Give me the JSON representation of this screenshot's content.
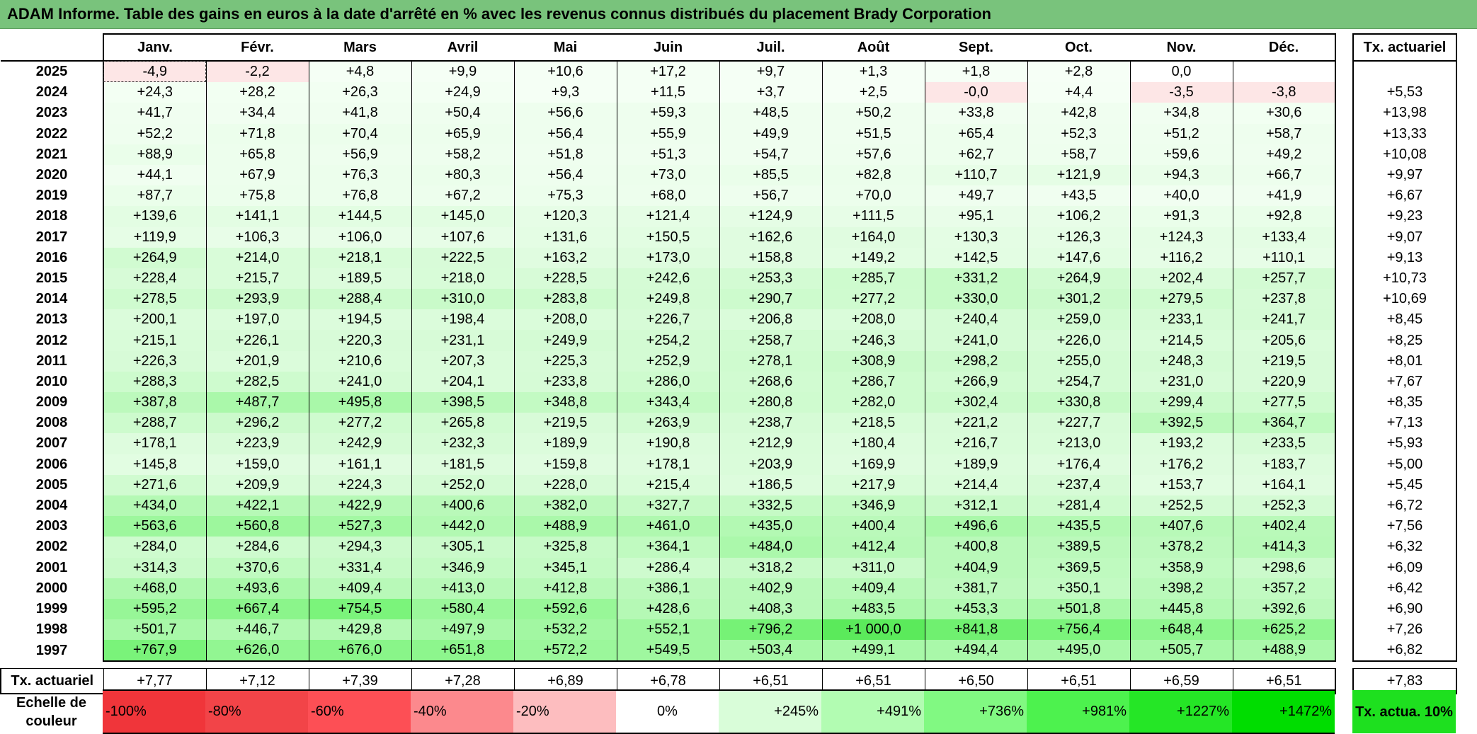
{
  "title": "ADAM Informe. Table des gains en euros à la date d'arrêté en % avec les revenus connus distribués du placement Brady Corporation",
  "months": [
    "Janv.",
    "Févr.",
    "Mars",
    "Avril",
    "Mai",
    "Juin",
    "Juil.",
    "Août",
    "Sept.",
    "Oct.",
    "Nov.",
    "Déc."
  ],
  "tx_header": "Tx. actuariel",
  "rows": [
    {
      "year": "2025",
      "values": [
        "-4,9",
        "-2,2",
        "+4,8",
        "+9,9",
        "+10,6",
        "+17,2",
        "+9,7",
        "+1,3",
        "+1,8",
        "+2,8",
        "0,0",
        ""
      ],
      "tx": ""
    },
    {
      "year": "2024",
      "values": [
        "+24,3",
        "+28,2",
        "+26,3",
        "+24,9",
        "+9,3",
        "+11,5",
        "+3,7",
        "+2,5",
        "-0,0",
        "+4,4",
        "-3,5",
        "-3,8"
      ],
      "tx": "+5,53"
    },
    {
      "year": "2023",
      "values": [
        "+41,7",
        "+34,4",
        "+41,8",
        "+50,4",
        "+56,6",
        "+59,3",
        "+48,5",
        "+50,2",
        "+33,8",
        "+42,8",
        "+34,8",
        "+30,6"
      ],
      "tx": "+13,98"
    },
    {
      "year": "2022",
      "values": [
        "+52,2",
        "+71,8",
        "+70,4",
        "+65,9",
        "+56,4",
        "+55,9",
        "+49,9",
        "+51,5",
        "+65,4",
        "+52,3",
        "+51,2",
        "+58,7"
      ],
      "tx": "+13,33"
    },
    {
      "year": "2021",
      "values": [
        "+88,9",
        "+65,8",
        "+56,9",
        "+58,2",
        "+51,8",
        "+51,3",
        "+54,7",
        "+57,6",
        "+62,7",
        "+58,7",
        "+59,6",
        "+49,2"
      ],
      "tx": "+10,08"
    },
    {
      "year": "2020",
      "values": [
        "+44,1",
        "+67,9",
        "+76,3",
        "+80,3",
        "+56,4",
        "+73,0",
        "+85,5",
        "+82,8",
        "+110,7",
        "+121,9",
        "+94,3",
        "+66,7"
      ],
      "tx": "+9,97"
    },
    {
      "year": "2019",
      "values": [
        "+87,7",
        "+75,8",
        "+76,8",
        "+67,2",
        "+75,3",
        "+68,0",
        "+56,7",
        "+70,0",
        "+49,7",
        "+43,5",
        "+40,0",
        "+41,9"
      ],
      "tx": "+6,67"
    },
    {
      "year": "2018",
      "values": [
        "+139,6",
        "+141,1",
        "+144,5",
        "+145,0",
        "+120,3",
        "+121,4",
        "+124,9",
        "+111,5",
        "+95,1",
        "+106,2",
        "+91,3",
        "+92,8"
      ],
      "tx": "+9,23"
    },
    {
      "year": "2017",
      "values": [
        "+119,9",
        "+106,3",
        "+106,0",
        "+107,6",
        "+131,6",
        "+150,5",
        "+162,6",
        "+164,0",
        "+130,3",
        "+126,3",
        "+124,3",
        "+133,4"
      ],
      "tx": "+9,07"
    },
    {
      "year": "2016",
      "values": [
        "+264,9",
        "+214,0",
        "+218,1",
        "+222,5",
        "+163,2",
        "+173,0",
        "+158,8",
        "+149,2",
        "+142,5",
        "+147,6",
        "+116,2",
        "+110,1"
      ],
      "tx": "+9,13"
    },
    {
      "year": "2015",
      "values": [
        "+228,4",
        "+215,7",
        "+189,5",
        "+218,0",
        "+228,5",
        "+242,6",
        "+253,3",
        "+285,7",
        "+331,2",
        "+264,9",
        "+202,4",
        "+257,7"
      ],
      "tx": "+10,73"
    },
    {
      "year": "2014",
      "values": [
        "+278,5",
        "+293,9",
        "+288,4",
        "+310,0",
        "+283,8",
        "+249,8",
        "+290,7",
        "+277,2",
        "+330,0",
        "+301,2",
        "+279,5",
        "+237,8"
      ],
      "tx": "+10,69"
    },
    {
      "year": "2013",
      "values": [
        "+200,1",
        "+197,0",
        "+194,5",
        "+198,4",
        "+208,0",
        "+226,7",
        "+206,8",
        "+208,0",
        "+240,4",
        "+259,0",
        "+233,1",
        "+241,7"
      ],
      "tx": "+8,45"
    },
    {
      "year": "2012",
      "values": [
        "+215,1",
        "+226,1",
        "+220,3",
        "+231,1",
        "+249,9",
        "+254,2",
        "+258,7",
        "+246,3",
        "+241,0",
        "+226,0",
        "+214,5",
        "+205,6"
      ],
      "tx": "+8,25"
    },
    {
      "year": "2011",
      "values": [
        "+226,3",
        "+201,9",
        "+210,6",
        "+207,3",
        "+225,3",
        "+252,9",
        "+278,1",
        "+308,9",
        "+298,2",
        "+255,0",
        "+248,3",
        "+219,5"
      ],
      "tx": "+8,01"
    },
    {
      "year": "2010",
      "values": [
        "+288,3",
        "+282,5",
        "+241,0",
        "+204,1",
        "+233,8",
        "+286,0",
        "+268,6",
        "+286,7",
        "+266,9",
        "+254,7",
        "+231,0",
        "+220,9"
      ],
      "tx": "+7,67"
    },
    {
      "year": "2009",
      "values": [
        "+387,8",
        "+487,7",
        "+495,8",
        "+398,5",
        "+348,8",
        "+343,4",
        "+280,8",
        "+282,0",
        "+302,4",
        "+330,8",
        "+299,4",
        "+277,5"
      ],
      "tx": "+8,35"
    },
    {
      "year": "2008",
      "values": [
        "+288,7",
        "+296,2",
        "+277,2",
        "+265,8",
        "+219,5",
        "+263,9",
        "+238,7",
        "+218,5",
        "+221,2",
        "+227,7",
        "+392,5",
        "+364,7"
      ],
      "tx": "+7,13"
    },
    {
      "year": "2007",
      "values": [
        "+178,1",
        "+223,9",
        "+242,9",
        "+232,3",
        "+189,9",
        "+190,8",
        "+212,9",
        "+180,4",
        "+216,7",
        "+213,0",
        "+193,2",
        "+233,5"
      ],
      "tx": "+5,93"
    },
    {
      "year": "2006",
      "values": [
        "+145,8",
        "+159,0",
        "+161,1",
        "+181,5",
        "+159,8",
        "+178,1",
        "+203,9",
        "+169,9",
        "+189,9",
        "+176,4",
        "+176,2",
        "+183,7"
      ],
      "tx": "+5,00"
    },
    {
      "year": "2005",
      "values": [
        "+271,6",
        "+209,9",
        "+224,3",
        "+252,0",
        "+228,0",
        "+215,4",
        "+186,5",
        "+217,9",
        "+214,4",
        "+237,4",
        "+153,7",
        "+164,1"
      ],
      "tx": "+5,45"
    },
    {
      "year": "2004",
      "values": [
        "+434,0",
        "+422,1",
        "+422,9",
        "+400,6",
        "+382,0",
        "+327,7",
        "+332,5",
        "+346,9",
        "+312,1",
        "+281,4",
        "+252,5",
        "+252,3"
      ],
      "tx": "+6,72"
    },
    {
      "year": "2003",
      "values": [
        "+563,6",
        "+560,8",
        "+527,3",
        "+442,0",
        "+488,9",
        "+461,0",
        "+435,0",
        "+400,4",
        "+496,6",
        "+435,5",
        "+407,6",
        "+402,4"
      ],
      "tx": "+7,56"
    },
    {
      "year": "2002",
      "values": [
        "+284,0",
        "+284,6",
        "+294,3",
        "+305,1",
        "+325,8",
        "+364,1",
        "+484,0",
        "+412,4",
        "+400,8",
        "+389,5",
        "+378,2",
        "+414,3"
      ],
      "tx": "+6,32"
    },
    {
      "year": "2001",
      "values": [
        "+314,3",
        "+370,6",
        "+331,4",
        "+346,9",
        "+345,1",
        "+286,4",
        "+318,2",
        "+311,0",
        "+404,9",
        "+369,5",
        "+358,9",
        "+298,6"
      ],
      "tx": "+6,09"
    },
    {
      "year": "2000",
      "values": [
        "+468,0",
        "+493,6",
        "+409,4",
        "+413,0",
        "+412,8",
        "+386,1",
        "+402,9",
        "+409,4",
        "+381,7",
        "+350,1",
        "+398,2",
        "+357,2"
      ],
      "tx": "+6,42"
    },
    {
      "year": "1999",
      "values": [
        "+595,2",
        "+667,4",
        "+754,5",
        "+580,4",
        "+592,6",
        "+428,6",
        "+408,3",
        "+483,5",
        "+453,3",
        "+501,8",
        "+445,8",
        "+392,6"
      ],
      "tx": "+6,90"
    },
    {
      "year": "1998",
      "values": [
        "+501,7",
        "+446,7",
        "+429,8",
        "+497,9",
        "+532,2",
        "+552,1",
        "+796,2",
        "+1 000,0",
        "+841,8",
        "+756,4",
        "+648,4",
        "+625,2"
      ],
      "tx": "+7,26"
    },
    {
      "year": "1997",
      "values": [
        "+767,9",
        "+626,0",
        "+676,0",
        "+651,8",
        "+572,2",
        "+549,5",
        "+503,4",
        "+499,1",
        "+494,4",
        "+495,0",
        "+505,7",
        "+488,9"
      ],
      "tx": "+6,82"
    }
  ],
  "footer": {
    "label": "Tx. actuariel",
    "values": [
      "+7,77",
      "+7,12",
      "+7,39",
      "+7,28",
      "+6,89",
      "+6,78",
      "+6,51",
      "+6,51",
      "+6,50",
      "+6,51",
      "+6,59",
      "+6,51"
    ],
    "tx": "+7,83"
  },
  "legend": {
    "label": "Echelle de couleur",
    "items": [
      {
        "text": "-100%",
        "color": "#f0353a",
        "align": "l"
      },
      {
        "text": "-80%",
        "color": "#f24448",
        "align": "l"
      },
      {
        "text": "-60%",
        "color": "#fd4f55",
        "align": "l"
      },
      {
        "text": "-40%",
        "color": "#fc898d",
        "align": "l"
      },
      {
        "text": "-20%",
        "color": "#fdbdbf",
        "align": "l"
      },
      {
        "text": "0%",
        "color": "#ffffff",
        "align": "m"
      },
      {
        "text": "+245%",
        "color": "#d9fdd9",
        "align": "r"
      },
      {
        "text": "+491%",
        "color": "#b2fcb2",
        "align": "r"
      },
      {
        "text": "+736%",
        "color": "#81f982",
        "align": "r"
      },
      {
        "text": "+981%",
        "color": "#4df24e",
        "align": "r"
      },
      {
        "text": "+1227%",
        "color": "#25e626",
        "align": "r"
      },
      {
        "text": "+1472%",
        "color": "#00dd00",
        "align": "r"
      }
    ],
    "tx_label": "Tx. actua. 10%",
    "tx_color": "#1ee01f"
  }
}
